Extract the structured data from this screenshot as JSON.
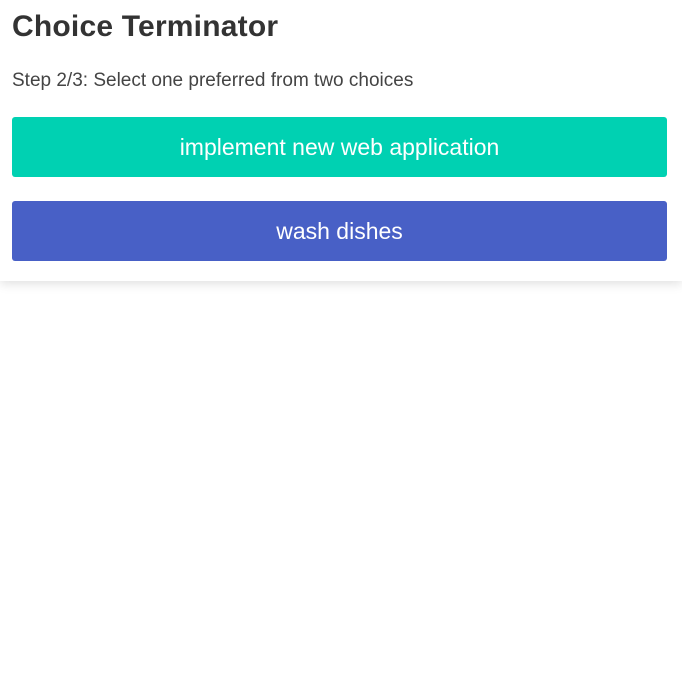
{
  "app": {
    "title": "Choice Terminator"
  },
  "step": {
    "text": "Step 2/3: Select one preferred from two choices"
  },
  "choices": [
    {
      "label": "implement new web application",
      "color": "#00d1b2"
    },
    {
      "label": "wash dishes",
      "color": "#4860c6"
    }
  ],
  "colors": {
    "title_text": "#333333",
    "step_text": "#444444",
    "background": "#ffffff"
  }
}
